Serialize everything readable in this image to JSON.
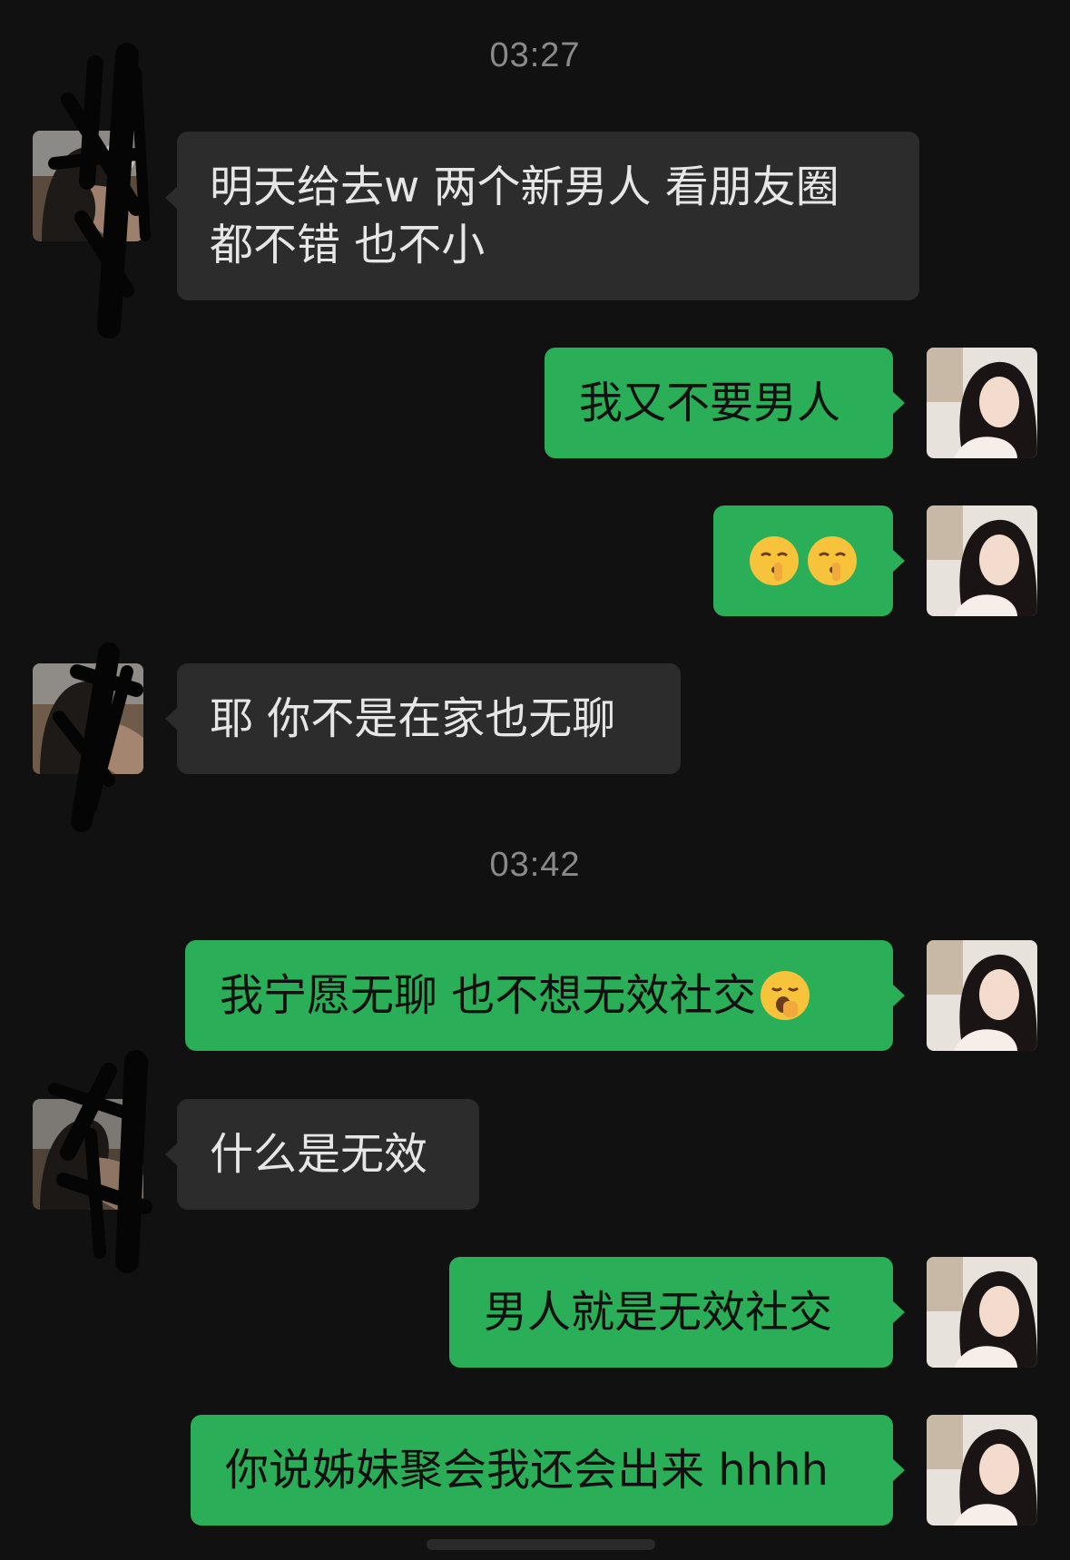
{
  "timestamps": [
    "03:27",
    "03:42"
  ],
  "messages": [
    {
      "side": "in",
      "text_line1": "明天给去w 两个新男人 看朋友圈",
      "text_line2": "都不错 也不小"
    },
    {
      "side": "out",
      "text": "我又不要男人"
    },
    {
      "side": "out",
      "emoji": [
        "shushing-face-emoji",
        "shushing-face-emoji"
      ]
    },
    {
      "side": "in",
      "text": "耶 你不是在家也无聊"
    },
    {
      "side": "out",
      "text": "我宁愿无聊 也不想无效社交",
      "emoji": "yawning-face-emoji"
    },
    {
      "side": "in",
      "text": "什么是无效"
    },
    {
      "side": "out",
      "text": "男人就是无效社交"
    },
    {
      "side": "out",
      "text": "你说姊妹聚会我还会出来 hhhh"
    }
  ],
  "colors": {
    "background": "#111111",
    "incoming_bubble": "#2c2c2c",
    "outgoing_bubble": "#2aae57",
    "timestamp": "#8a8a8a"
  }
}
